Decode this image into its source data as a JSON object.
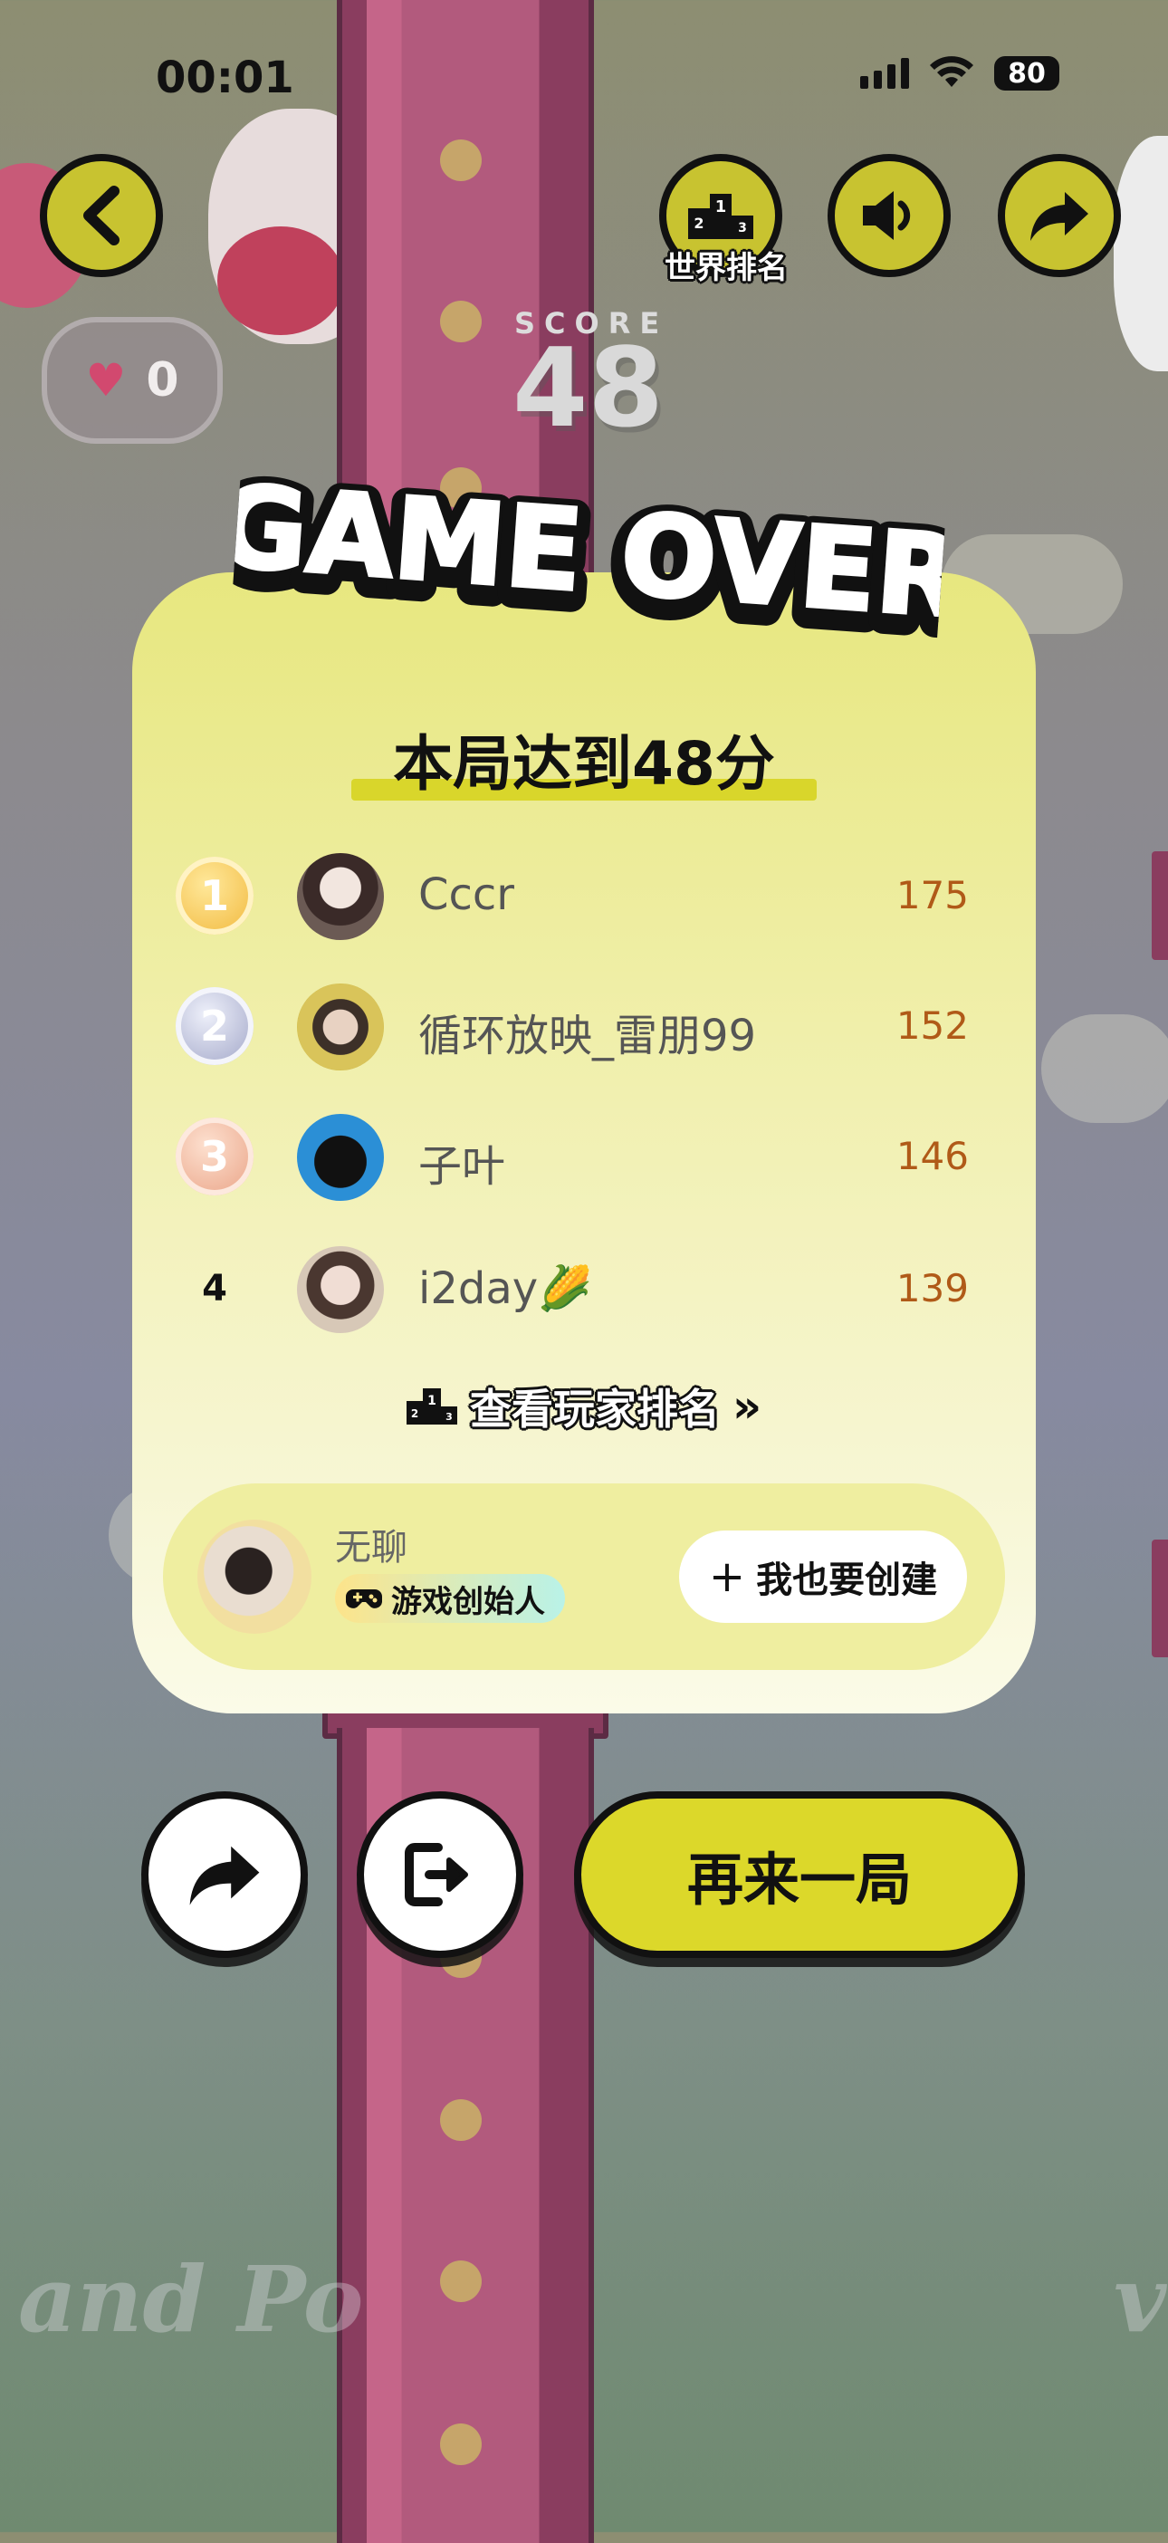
{
  "status_bar": {
    "time": "00:01",
    "battery": "80"
  },
  "header": {
    "world_rank_label": "世界排名"
  },
  "lives": {
    "count": "0",
    "heart_icon": "♥"
  },
  "score": {
    "label": "SCORE",
    "value": "48"
  },
  "game_over": {
    "title": "GAME OVER"
  },
  "result": {
    "title": "本局达到48分"
  },
  "leaderboard": [
    {
      "rank": "1",
      "name": "Cccr",
      "score": "175",
      "medal": "gold"
    },
    {
      "rank": "2",
      "name": "循环放映_雷朋99",
      "score": "152",
      "medal": "silver"
    },
    {
      "rank": "3",
      "name": "子叶",
      "score": "146",
      "medal": "bronze"
    },
    {
      "rank": "4",
      "name": "i2day🌽",
      "score": "139",
      "medal": ""
    }
  ],
  "view_ranking": {
    "label": "查看玩家排名",
    "chevrons": "»"
  },
  "creator": {
    "name": "无聊",
    "badge": "游戏创始人",
    "create_label": "我也要创建",
    "plus": "+"
  },
  "actions": {
    "retry_label": "再来一局"
  },
  "background": {
    "script_left": "and Po",
    "script_right": "v"
  },
  "colors": {
    "accent": "#dcd82a",
    "score_orange": "#b05a18",
    "card_top": "#e7e77f",
    "card_bottom": "#fbfbe8"
  }
}
